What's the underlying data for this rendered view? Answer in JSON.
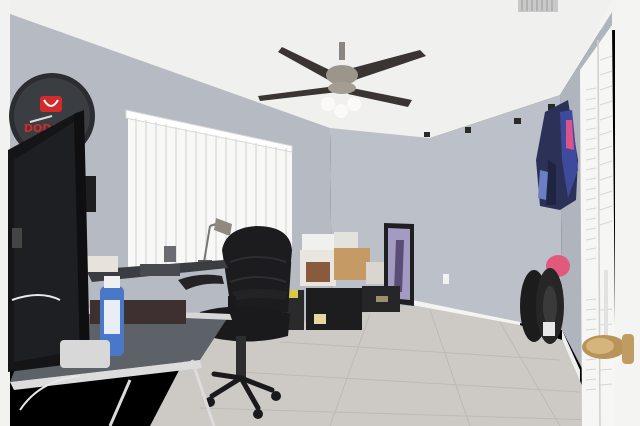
{
  "scene": {
    "clock_logo_text": "DODGE",
    "colors": {
      "ceiling": "#f2f2f0",
      "wall": "#b9bcc4",
      "wall_shadow": "#a6aab3",
      "floor": "#cfccc8",
      "baseboard": "#f4f4f2",
      "blinds": "#f7f7f5",
      "chair": "#1c1c1f",
      "monitor": "#151517",
      "desk_glass": "#5d6168",
      "jacket_blue": "#3e4a9c",
      "jacket_pink": "#d9548c",
      "ball_pink": "#e2597e"
    }
  }
}
